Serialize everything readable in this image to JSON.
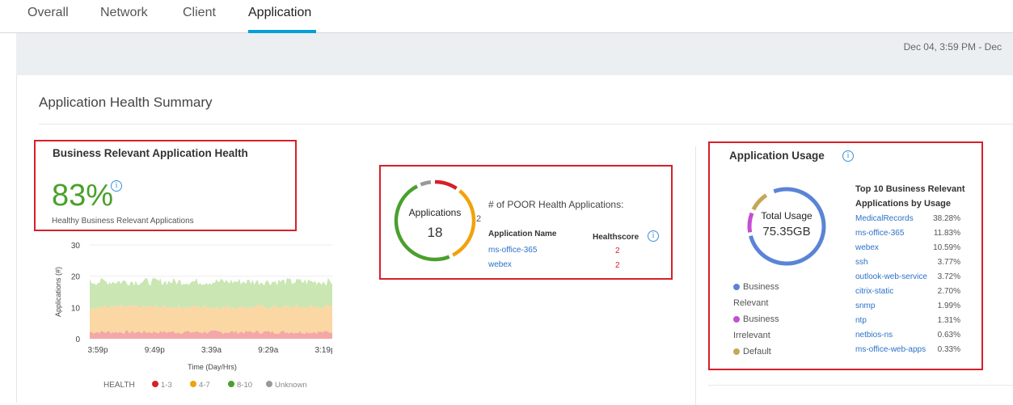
{
  "tabs": [
    {
      "label": "Overall"
    },
    {
      "label": "Network"
    },
    {
      "label": "Client"
    },
    {
      "label": "Application"
    }
  ],
  "date_range": "Dec 04, 3:59 PM - Dec",
  "section_title": "Application Health Summary",
  "health_card": {
    "title": "Business Relevant Application Health",
    "percent": "83%",
    "subtitle": "Healthy Business Relevant Applications",
    "info_icon": "i"
  },
  "poor_card": {
    "donut_label": "Applications",
    "donut_value": "18",
    "side_count": "2",
    "heading": "# of POOR Health Applications:",
    "col_name": "Application Name",
    "col_score": "Healthscore",
    "rows": [
      {
        "name": "ms-office-365",
        "score": "2"
      },
      {
        "name": "webex",
        "score": "2"
      }
    ],
    "segments": [
      {
        "label": "poor",
        "color": "#d6202a",
        "fraction": 0.11
      },
      {
        "label": "fair",
        "color": "#f0a30a",
        "fraction": 0.33
      },
      {
        "label": "good",
        "color": "#4aa02c",
        "fraction": 0.5
      },
      {
        "label": "unknown",
        "color": "#999999",
        "fraction": 0.06
      }
    ]
  },
  "usage_card": {
    "title": "Application Usage",
    "total_label": "Total Usage",
    "total_value": "75.35GB",
    "legend": [
      {
        "label": "Business Relevant",
        "color": "#5b84d6"
      },
      {
        "label": "Business Irrelevant",
        "color": "#c34fd2"
      },
      {
        "label": "Default",
        "color": "#c4a85a"
      }
    ],
    "top10_title": "Top 10 Business Relevant Applications by Usage",
    "top10": [
      {
        "name": "MedicalRecords",
        "pct": "38.28%"
      },
      {
        "name": "ms-office-365",
        "pct": "11.83%"
      },
      {
        "name": "webex",
        "pct": "10.59%"
      },
      {
        "name": "ssh",
        "pct": "3.77%"
      },
      {
        "name": "outlook-web-service",
        "pct": "3.72%"
      },
      {
        "name": "citrix-static",
        "pct": "2.70%"
      },
      {
        "name": "snmp",
        "pct": "1.99%"
      },
      {
        "name": "ntp",
        "pct": "1.31%"
      },
      {
        "name": "netbios-ns",
        "pct": "0.63%"
      },
      {
        "name": "ms-office-web-apps",
        "pct": "0.33%"
      }
    ],
    "donut": [
      {
        "label": "Business Relevant",
        "color": "#5b84d6",
        "fraction": 0.78
      },
      {
        "label": "Business Irrelevant",
        "color": "#c34fd2",
        "fraction": 0.1
      },
      {
        "label": "Default",
        "color": "#c4a85a",
        "fraction": 0.1
      }
    ]
  },
  "chart_data": {
    "type": "area",
    "ylabel": "Applications (#)",
    "xlabel": "Time (Day/Hrs)",
    "ylim": [
      0,
      30
    ],
    "yticks": [
      "30",
      "20",
      "10",
      "0"
    ],
    "xticks": [
      "3:59p",
      "9:49p",
      "3:39a",
      "9:29a",
      "3:19p"
    ],
    "series": [
      {
        "name": "1-3",
        "color": "#f4a7a7",
        "level": 2
      },
      {
        "name": "4-7",
        "color": "#fbd7a4",
        "level": 10
      },
      {
        "name": "8-10",
        "color": "#c9e6b3",
        "level": 18
      },
      {
        "name": "Unknown",
        "color": "#cccccc",
        "level": 0
      }
    ],
    "legend_title": "HEALTH",
    "legend_colors": {
      "1-3": "#d6202a",
      "4-7": "#f0a30a",
      "8-10": "#4aa02c",
      "Unknown": "#999999"
    }
  }
}
